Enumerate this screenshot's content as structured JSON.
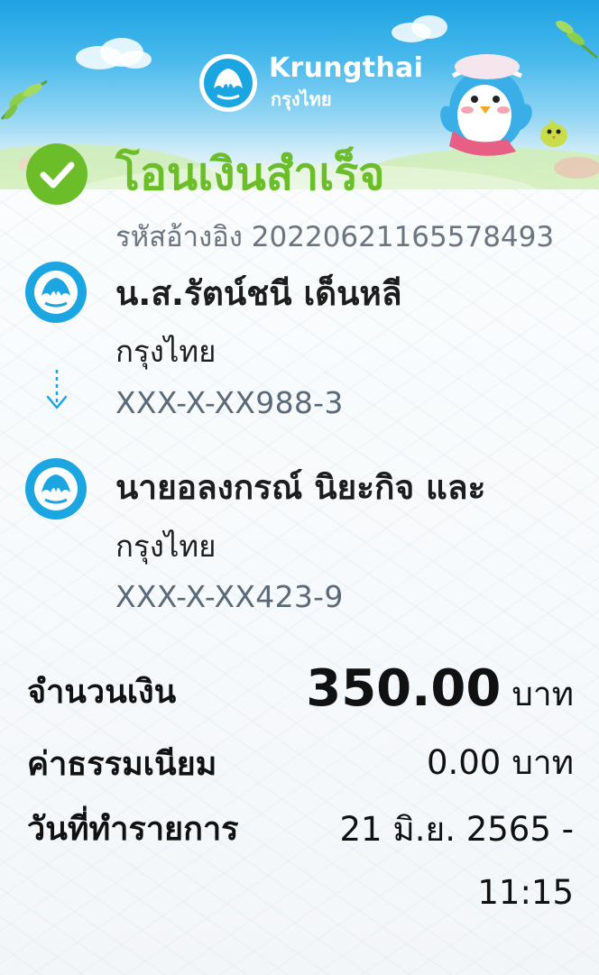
{
  "brand": {
    "name_en": "Krungthai",
    "name_th": "กรุงไทย",
    "logo_icon": "krungthai-bird-logo-icon",
    "colors": {
      "primary_blue": "#1ba5e1",
      "success_green": "#6cbd2a"
    }
  },
  "status": {
    "title": "โอนเงินสำเร็จ",
    "icon": "check-circle-icon",
    "reference_label": "รหัสอ้างอิง",
    "reference_number": "2022062116557849​3"
  },
  "sender": {
    "name": "น.ส.รัตน์ชนี เด็นหลี",
    "bank": "กรุงไทย",
    "account": "XXX-X-XX988-3"
  },
  "receiver": {
    "name": "นายอลงกรณ์ นิยะกิจ และ",
    "bank": "กรุงไทย",
    "account": "XXX-X-XX423-9"
  },
  "summary": {
    "amount_label": "จำนวนเงิน",
    "amount_value": "350.00",
    "amount_unit": "บาท",
    "fee_label": "ค่าธรรมเนียม",
    "fee_value": "0.00",
    "fee_unit": "บาท",
    "date_label": "วันที่ทำรายการ",
    "date_value": "21 มิ.ย. 2565 -",
    "time_value": "11:15"
  }
}
